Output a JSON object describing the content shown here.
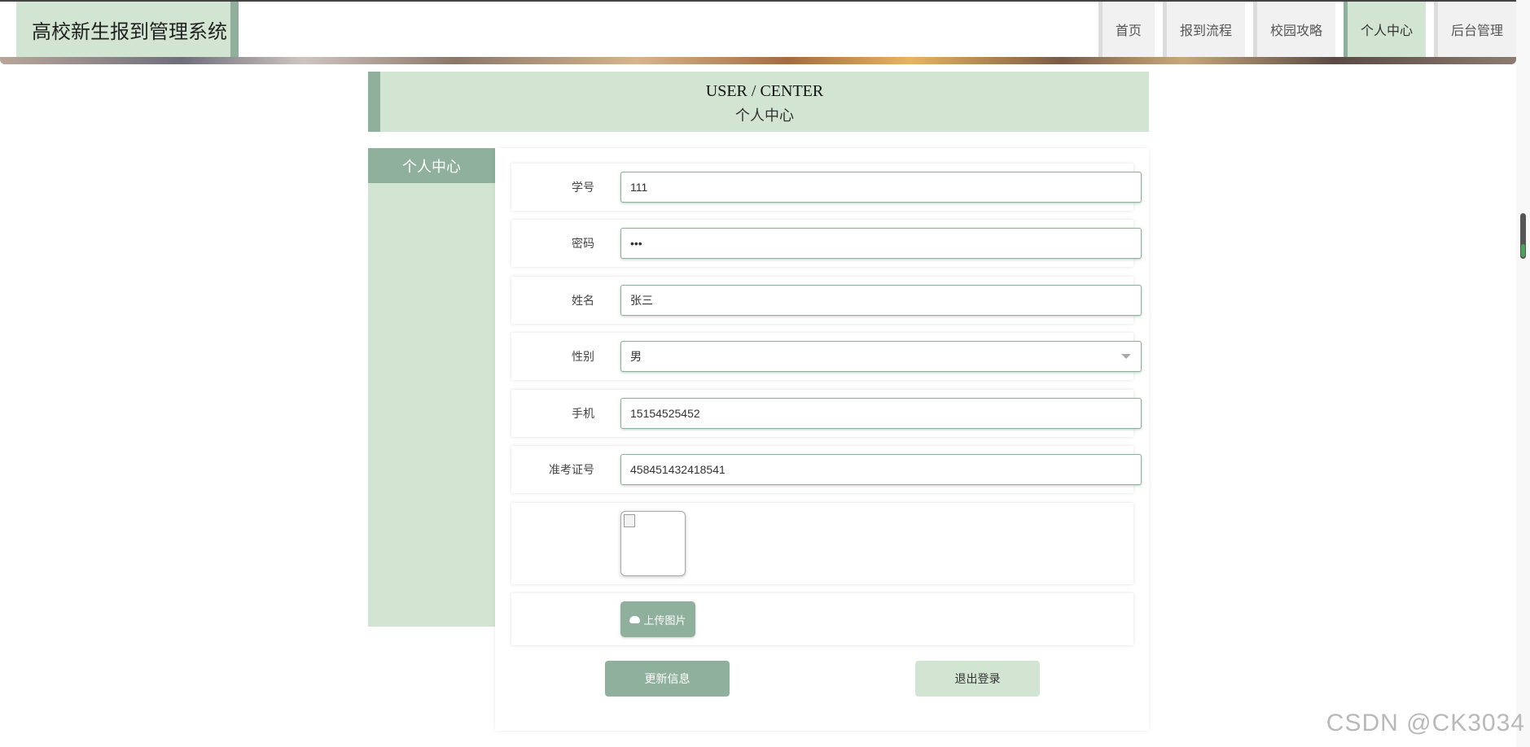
{
  "header": {
    "logo": "高校新生报到管理系统",
    "nav": [
      {
        "label": "首页",
        "active": false
      },
      {
        "label": "报到流程",
        "active": false
      },
      {
        "label": "校园攻略",
        "active": false
      },
      {
        "label": "个人中心",
        "active": true
      },
      {
        "label": "后台管理",
        "active": false
      }
    ]
  },
  "title": {
    "en": "USER / CENTER",
    "zh": "个人中心"
  },
  "sidebar": {
    "heading": "个人中心"
  },
  "form": {
    "student_id": {
      "label": "学号",
      "value": "111"
    },
    "password": {
      "label": "密码",
      "value": "•••"
    },
    "name": {
      "label": "姓名",
      "value": "张三"
    },
    "gender": {
      "label": "性别",
      "value": "男"
    },
    "phone": {
      "label": "手机",
      "value": "15154525452"
    },
    "admission_no": {
      "label": "准考证号",
      "value": "458451432418541"
    },
    "upload_label": "上传图片",
    "update_button": "更新信息",
    "logout_button": "退出登录"
  },
  "watermark": "CSDN @CK3034",
  "colors": {
    "accent": "#8fb09c",
    "light": "#d2e4d2"
  }
}
